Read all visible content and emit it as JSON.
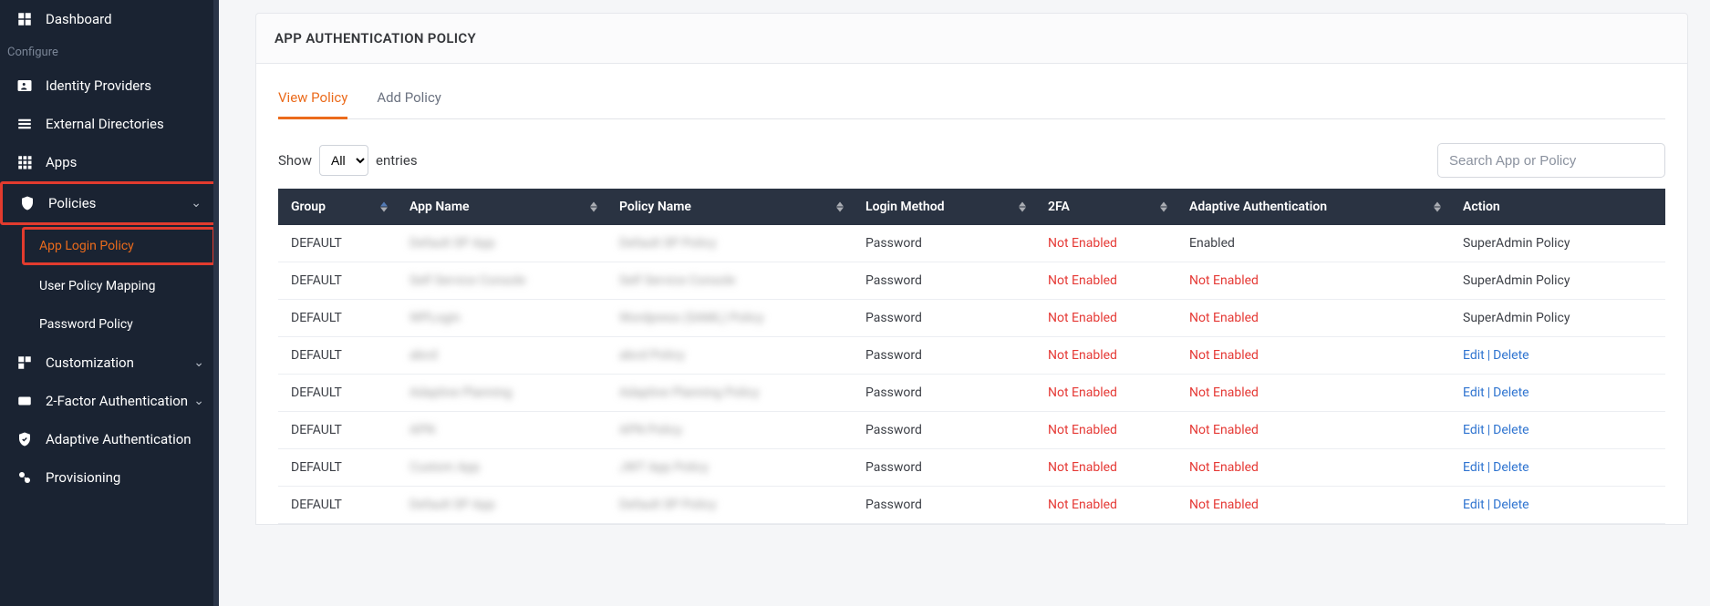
{
  "sidebar": {
    "items": [
      {
        "label": "Dashboard"
      },
      {
        "label": "Configure",
        "section": true
      },
      {
        "label": "Identity Providers"
      },
      {
        "label": "External Directories"
      },
      {
        "label": "Apps"
      },
      {
        "label": "Policies",
        "expandable": true,
        "highlight": true
      },
      {
        "label": "App Login Policy",
        "sub": true,
        "active": true,
        "highlight": true
      },
      {
        "label": "User Policy Mapping",
        "sub": true
      },
      {
        "label": "Password Policy",
        "sub": true
      },
      {
        "label": "Customization",
        "expandable": true
      },
      {
        "label": "2-Factor Authentication",
        "expandable": true
      },
      {
        "label": "Adaptive Authentication"
      },
      {
        "label": "Provisioning"
      }
    ]
  },
  "header": {
    "title": "APP AUTHENTICATION POLICY"
  },
  "tabs": [
    {
      "label": "View Policy",
      "active": true
    },
    {
      "label": "Add Policy"
    }
  ],
  "entries": {
    "show_label": "Show",
    "entries_label": "entries",
    "options": [
      "All"
    ],
    "selected": "All"
  },
  "search": {
    "placeholder": "Search App or Policy"
  },
  "table": {
    "columns": [
      "Group",
      "App Name",
      "Policy Name",
      "Login Method",
      "2FA",
      "Adaptive Authentication",
      "Action"
    ],
    "rows": [
      {
        "group": "DEFAULT",
        "app": "Default SP App",
        "policy": "Default SP Policy",
        "login": "Password",
        "twofa": "Not Enabled",
        "adaptive": "Enabled",
        "action_text": "SuperAdmin Policy"
      },
      {
        "group": "DEFAULT",
        "app": "Self Service Console",
        "policy": "Self Service Console",
        "login": "Password",
        "twofa": "Not Enabled",
        "adaptive": "Not Enabled",
        "action_text": "SuperAdmin Policy"
      },
      {
        "group": "DEFAULT",
        "app": "WPLogin",
        "policy": "Wordpress (SAML) Policy",
        "login": "Password",
        "twofa": "Not Enabled",
        "adaptive": "Not Enabled",
        "action_text": "SuperAdmin Policy"
      },
      {
        "group": "DEFAULT",
        "app": "abcd",
        "policy": "abcd Policy",
        "login": "Password",
        "twofa": "Not Enabled",
        "adaptive": "Not Enabled",
        "action_links": [
          "Edit",
          "Delete"
        ]
      },
      {
        "group": "DEFAULT",
        "app": "Adaptive Planning",
        "policy": "Adaptive Planning Policy",
        "login": "Password",
        "twofa": "Not Enabled",
        "adaptive": "Not Enabled",
        "action_links": [
          "Edit",
          "Delete"
        ]
      },
      {
        "group": "DEFAULT",
        "app": "APN",
        "policy": "APN Policy",
        "login": "Password",
        "twofa": "Not Enabled",
        "adaptive": "Not Enabled",
        "action_links": [
          "Edit",
          "Delete"
        ]
      },
      {
        "group": "DEFAULT",
        "app": "Custom App",
        "policy": "JWT App Policy",
        "login": "Password",
        "twofa": "Not Enabled",
        "adaptive": "Not Enabled",
        "action_links": [
          "Edit",
          "Delete"
        ]
      },
      {
        "group": "DEFAULT",
        "app": "Default SP App",
        "policy": "Default SP Policy",
        "login": "Password",
        "twofa": "Not Enabled",
        "adaptive": "Not Enabled",
        "action_links": [
          "Edit",
          "Delete"
        ]
      }
    ]
  }
}
